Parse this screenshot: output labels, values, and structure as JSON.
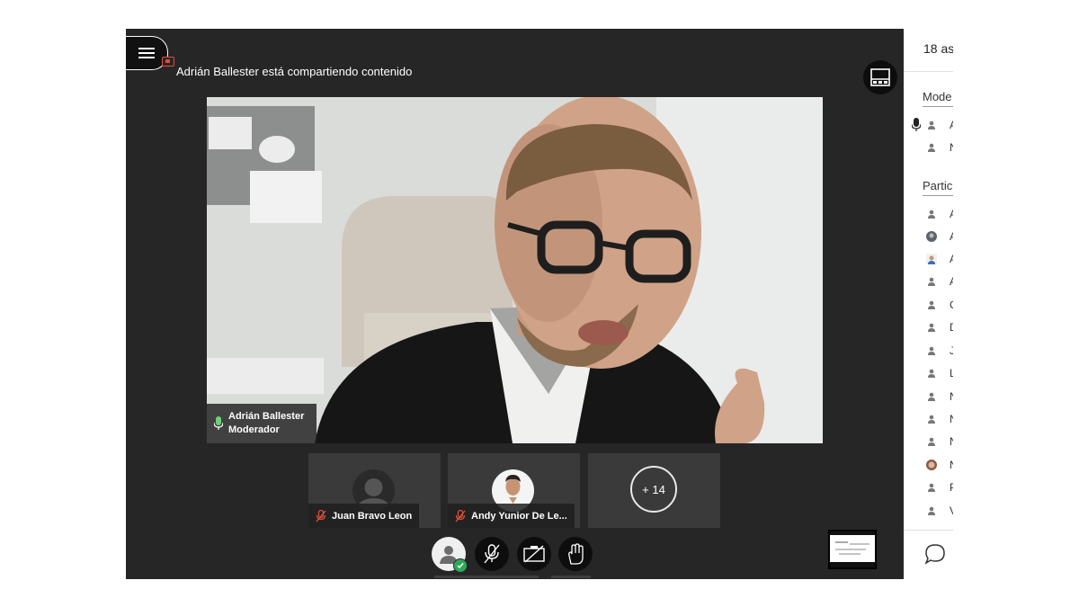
{
  "banner": {
    "sharing_text": "Adrián Ballester está compartiendo contenido"
  },
  "main_video": {
    "name": "Adrián Ballester",
    "role": "Moderador"
  },
  "thumbnails": [
    {
      "name": "Juan Bravo Leon"
    },
    {
      "name": "Andy Yunior De Le..."
    }
  ],
  "more_participants": {
    "label": "+ 14"
  },
  "panel": {
    "attendee_count": "18 as",
    "moderators_header": "Mode",
    "participants_header": "Partic",
    "moderators": [
      {
        "initial": "A"
      },
      {
        "initial": "N"
      }
    ],
    "participants": [
      {
        "initial": "A"
      },
      {
        "initial": "A"
      },
      {
        "initial": "A"
      },
      {
        "initial": "A"
      },
      {
        "initial": "C"
      },
      {
        "initial": "D"
      },
      {
        "initial": "J"
      },
      {
        "initial": "L"
      },
      {
        "initial": "N"
      },
      {
        "initial": "N"
      },
      {
        "initial": "N"
      },
      {
        "initial": "N"
      },
      {
        "initial": "P"
      },
      {
        "initial": "V"
      }
    ]
  },
  "colors": {
    "stage_bg": "#262626",
    "muted_red": "#e0533f",
    "status_green": "#2ea95a",
    "speaking_green": "#6bd17a"
  }
}
